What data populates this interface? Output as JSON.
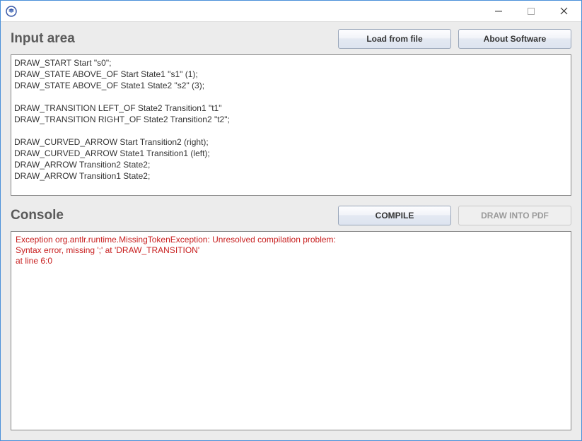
{
  "titlebar": {
    "app_icon_name": "app-icon"
  },
  "input_section": {
    "title": "Input area",
    "load_button": "Load from file",
    "about_button": "About Software",
    "code": "DRAW_START Start \"s0\";\nDRAW_STATE ABOVE_OF Start State1 \"s1\" (1);\nDRAW_STATE ABOVE_OF State1 State2 \"s2\" (3);\n\nDRAW_TRANSITION LEFT_OF State2 Transition1 \"t1\"\nDRAW_TRANSITION RIGHT_OF State2 Transition2 \"t2\";\n\nDRAW_CURVED_ARROW Start Transition2 (right);\nDRAW_CURVED_ARROW State1 Transition1 (left);\nDRAW_ARROW Transition2 State2;\nDRAW_ARROW Transition1 State2;"
  },
  "console_section": {
    "title": "Console",
    "compile_button": "COMPILE",
    "draw_pdf_button": "DRAW INTO PDF",
    "output": "Exception org.antlr.runtime.MissingTokenException: Unresolved compilation problem:\nSyntax error, missing ';' at 'DRAW_TRANSITION'\nat line 6:0"
  }
}
